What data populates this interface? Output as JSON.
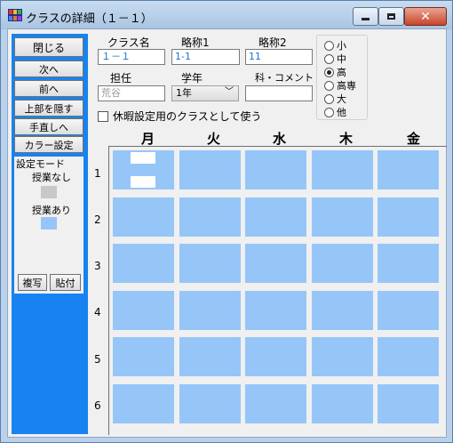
{
  "window": {
    "title": "クラスの詳細（１－１）",
    "controls": [
      "minimize",
      "maximize",
      "close"
    ]
  },
  "left_panel": {
    "buttons": [
      "閉じる",
      "次へ",
      "前へ",
      "上部を隠す",
      "手直しへ",
      "カラー設定"
    ],
    "mode_title": "設定モード",
    "no_class_label": "授業なし",
    "has_class_label": "授業あり",
    "copy_label": "複写",
    "paste_label": "貼付"
  },
  "form": {
    "class_name_label": "クラス名",
    "class_name_value": "１－１",
    "abbr1_label": "略称1",
    "abbr1_value": "1-1",
    "abbr2_label": "略称2",
    "abbr2_value": "11",
    "teacher_label": "担任",
    "teacher_value": "荒谷",
    "grade_label": "学年",
    "grade_value": "1年",
    "comment_label": "科・コメント",
    "comment_value": "",
    "holiday_checkbox_label": "休暇設定用のクラスとして使う"
  },
  "school_level": {
    "options": [
      "小",
      "中",
      "高",
      "高専",
      "大",
      "他"
    ],
    "selected": "高"
  },
  "timetable": {
    "days": [
      "月",
      "火",
      "水",
      "木",
      "金"
    ],
    "periods": [
      "1",
      "2",
      "3",
      "4",
      "5",
      "6"
    ]
  },
  "colors": {
    "panel_blue": "#1783f2",
    "class_cell": "#96c6f8",
    "no_class_swatch": "#c8c8c8",
    "has_class_swatch": "#96c6f8"
  }
}
